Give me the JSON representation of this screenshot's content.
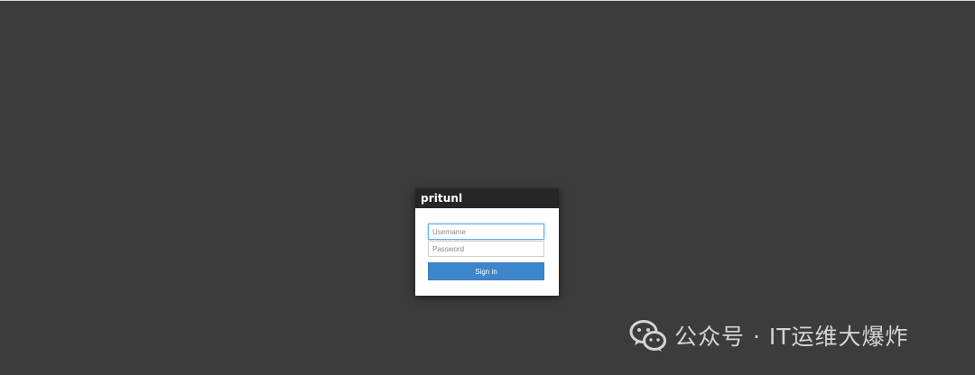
{
  "app": {
    "logo_text": "pritunl"
  },
  "login": {
    "username_placeholder": "Username",
    "password_placeholder": "Password",
    "signin_label": "Sign in"
  },
  "watermark": {
    "icon": "wechat-icon",
    "text": "公众号 · IT运维大爆炸"
  },
  "colors": {
    "background": "#3c3c3c",
    "header": "#262626",
    "button": "#3d86cb",
    "focus_border": "#66afe9"
  }
}
